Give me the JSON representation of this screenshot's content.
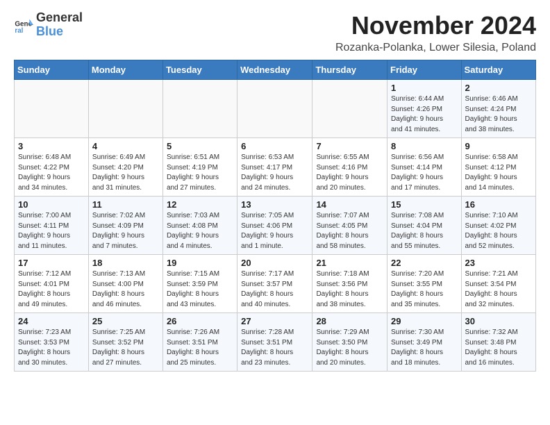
{
  "logo": {
    "line1": "General",
    "line2": "Blue"
  },
  "header": {
    "month": "November 2024",
    "location": "Rozanka-Polanka, Lower Silesia, Poland"
  },
  "weekdays": [
    "Sunday",
    "Monday",
    "Tuesday",
    "Wednesday",
    "Thursday",
    "Friday",
    "Saturday"
  ],
  "weeks": [
    [
      {
        "day": "",
        "detail": ""
      },
      {
        "day": "",
        "detail": ""
      },
      {
        "day": "",
        "detail": ""
      },
      {
        "day": "",
        "detail": ""
      },
      {
        "day": "",
        "detail": ""
      },
      {
        "day": "1",
        "detail": "Sunrise: 6:44 AM\nSunset: 4:26 PM\nDaylight: 9 hours\nand 41 minutes."
      },
      {
        "day": "2",
        "detail": "Sunrise: 6:46 AM\nSunset: 4:24 PM\nDaylight: 9 hours\nand 38 minutes."
      }
    ],
    [
      {
        "day": "3",
        "detail": "Sunrise: 6:48 AM\nSunset: 4:22 PM\nDaylight: 9 hours\nand 34 minutes."
      },
      {
        "day": "4",
        "detail": "Sunrise: 6:49 AM\nSunset: 4:20 PM\nDaylight: 9 hours\nand 31 minutes."
      },
      {
        "day": "5",
        "detail": "Sunrise: 6:51 AM\nSunset: 4:19 PM\nDaylight: 9 hours\nand 27 minutes."
      },
      {
        "day": "6",
        "detail": "Sunrise: 6:53 AM\nSunset: 4:17 PM\nDaylight: 9 hours\nand 24 minutes."
      },
      {
        "day": "7",
        "detail": "Sunrise: 6:55 AM\nSunset: 4:16 PM\nDaylight: 9 hours\nand 20 minutes."
      },
      {
        "day": "8",
        "detail": "Sunrise: 6:56 AM\nSunset: 4:14 PM\nDaylight: 9 hours\nand 17 minutes."
      },
      {
        "day": "9",
        "detail": "Sunrise: 6:58 AM\nSunset: 4:12 PM\nDaylight: 9 hours\nand 14 minutes."
      }
    ],
    [
      {
        "day": "10",
        "detail": "Sunrise: 7:00 AM\nSunset: 4:11 PM\nDaylight: 9 hours\nand 11 minutes."
      },
      {
        "day": "11",
        "detail": "Sunrise: 7:02 AM\nSunset: 4:09 PM\nDaylight: 9 hours\nand 7 minutes."
      },
      {
        "day": "12",
        "detail": "Sunrise: 7:03 AM\nSunset: 4:08 PM\nDaylight: 9 hours\nand 4 minutes."
      },
      {
        "day": "13",
        "detail": "Sunrise: 7:05 AM\nSunset: 4:06 PM\nDaylight: 9 hours\nand 1 minute."
      },
      {
        "day": "14",
        "detail": "Sunrise: 7:07 AM\nSunset: 4:05 PM\nDaylight: 8 hours\nand 58 minutes."
      },
      {
        "day": "15",
        "detail": "Sunrise: 7:08 AM\nSunset: 4:04 PM\nDaylight: 8 hours\nand 55 minutes."
      },
      {
        "day": "16",
        "detail": "Sunrise: 7:10 AM\nSunset: 4:02 PM\nDaylight: 8 hours\nand 52 minutes."
      }
    ],
    [
      {
        "day": "17",
        "detail": "Sunrise: 7:12 AM\nSunset: 4:01 PM\nDaylight: 8 hours\nand 49 minutes."
      },
      {
        "day": "18",
        "detail": "Sunrise: 7:13 AM\nSunset: 4:00 PM\nDaylight: 8 hours\nand 46 minutes."
      },
      {
        "day": "19",
        "detail": "Sunrise: 7:15 AM\nSunset: 3:59 PM\nDaylight: 8 hours\nand 43 minutes."
      },
      {
        "day": "20",
        "detail": "Sunrise: 7:17 AM\nSunset: 3:57 PM\nDaylight: 8 hours\nand 40 minutes."
      },
      {
        "day": "21",
        "detail": "Sunrise: 7:18 AM\nSunset: 3:56 PM\nDaylight: 8 hours\nand 38 minutes."
      },
      {
        "day": "22",
        "detail": "Sunrise: 7:20 AM\nSunset: 3:55 PM\nDaylight: 8 hours\nand 35 minutes."
      },
      {
        "day": "23",
        "detail": "Sunrise: 7:21 AM\nSunset: 3:54 PM\nDaylight: 8 hours\nand 32 minutes."
      }
    ],
    [
      {
        "day": "24",
        "detail": "Sunrise: 7:23 AM\nSunset: 3:53 PM\nDaylight: 8 hours\nand 30 minutes."
      },
      {
        "day": "25",
        "detail": "Sunrise: 7:25 AM\nSunset: 3:52 PM\nDaylight: 8 hours\nand 27 minutes."
      },
      {
        "day": "26",
        "detail": "Sunrise: 7:26 AM\nSunset: 3:51 PM\nDaylight: 8 hours\nand 25 minutes."
      },
      {
        "day": "27",
        "detail": "Sunrise: 7:28 AM\nSunset: 3:51 PM\nDaylight: 8 hours\nand 23 minutes."
      },
      {
        "day": "28",
        "detail": "Sunrise: 7:29 AM\nSunset: 3:50 PM\nDaylight: 8 hours\nand 20 minutes."
      },
      {
        "day": "29",
        "detail": "Sunrise: 7:30 AM\nSunset: 3:49 PM\nDaylight: 8 hours\nand 18 minutes."
      },
      {
        "day": "30",
        "detail": "Sunrise: 7:32 AM\nSunset: 3:48 PM\nDaylight: 8 hours\nand 16 minutes."
      }
    ]
  ]
}
